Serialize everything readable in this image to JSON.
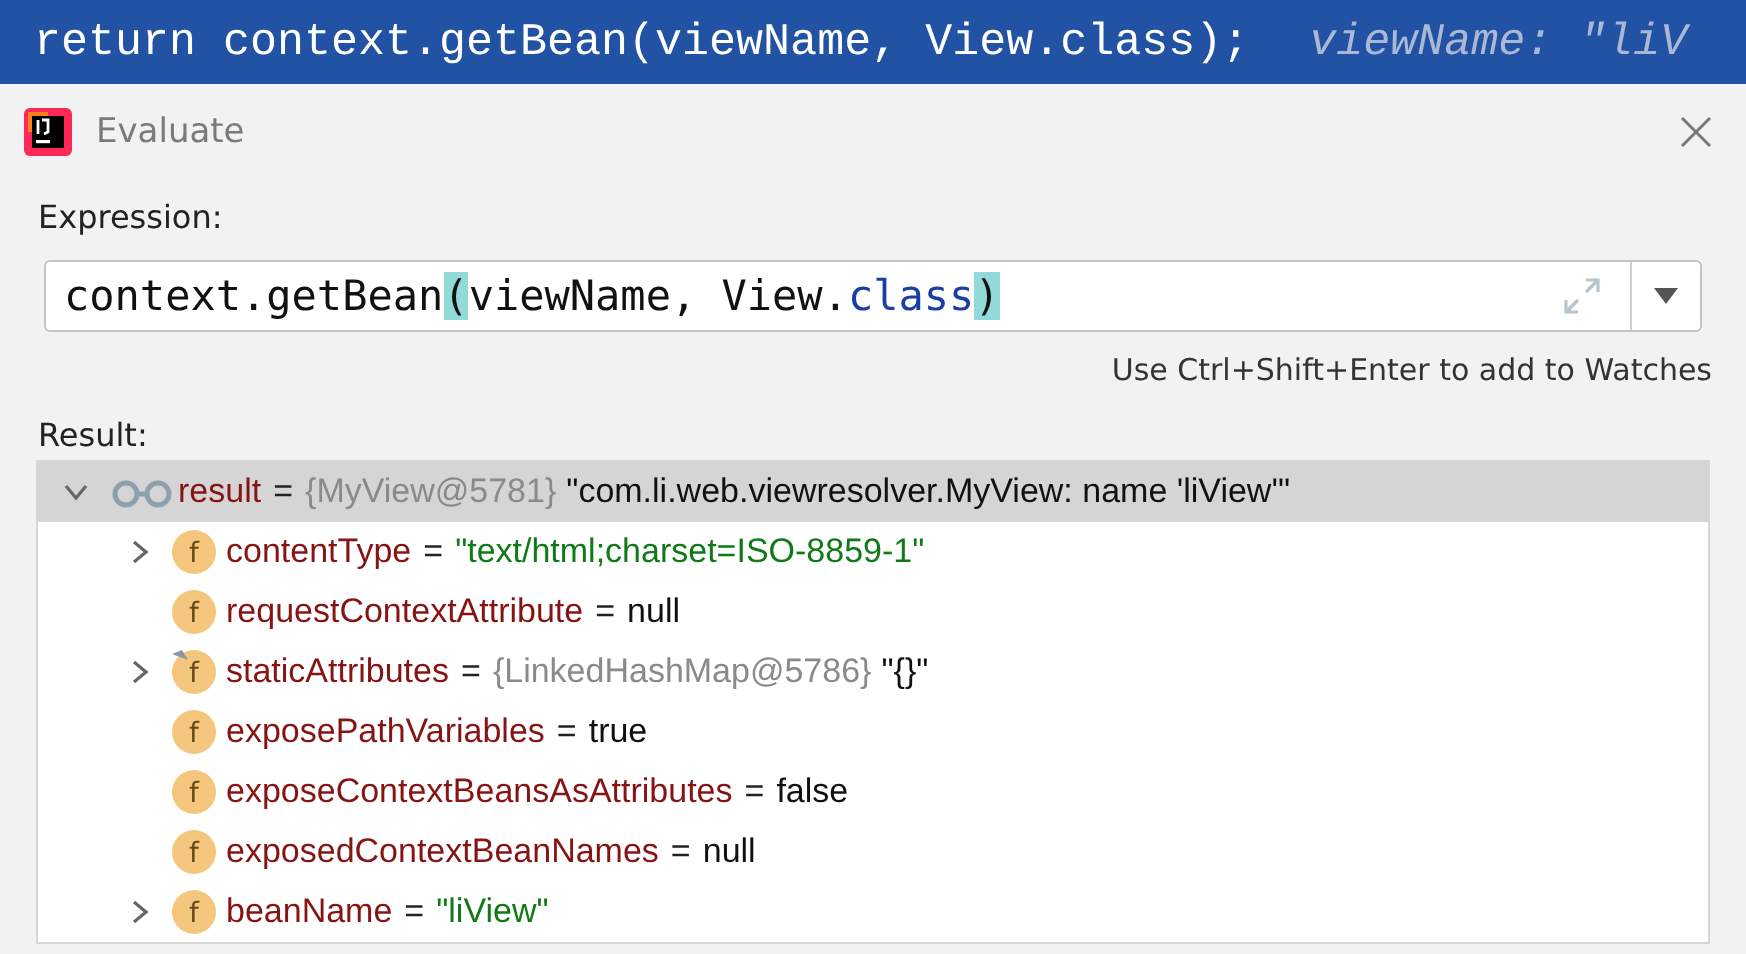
{
  "code_line": {
    "code": "return context.getBean(viewName, View.class);",
    "inline_hint": "viewName: \"liV"
  },
  "dialog": {
    "title": "Evaluate"
  },
  "expression": {
    "label": "Expression:",
    "segments": [
      {
        "text": "context.getBean",
        "kind": "plain"
      },
      {
        "text": "(",
        "kind": "brace_match"
      },
      {
        "text": "viewName, View.",
        "kind": "plain"
      },
      {
        "text": "class",
        "kind": "keyword"
      },
      {
        "text": ")",
        "kind": "brace_match"
      }
    ],
    "hint": "Use Ctrl+Shift+Enter to add to Watches"
  },
  "result": {
    "label": "Result:",
    "tree": [
      {
        "kind": "watch",
        "name": "result",
        "operator": "=",
        "type_ref": "{MyView@5781}",
        "value": {
          "text": "\"com.li.web.viewresolver.MyView: name 'liView'\"",
          "kind": "plain"
        },
        "selected": true,
        "expanded": true,
        "children": [
          {
            "kind": "field",
            "badge": "f",
            "name": "contentType",
            "operator": "=",
            "value": {
              "text": "\"text/html;charset=ISO-8859-1\"",
              "kind": "string"
            },
            "selected": false,
            "expanded": false
          },
          {
            "kind": "field",
            "badge": "f",
            "name": "requestContextAttribute",
            "operator": "=",
            "value": {
              "text": "null",
              "kind": "plain"
            },
            "selected": false
          },
          {
            "kind": "static_field",
            "badge": "f",
            "name": "staticAttributes",
            "operator": "=",
            "type_ref": "{LinkedHashMap@5786}",
            "value": {
              "text": "\"{}\"",
              "kind": "plain"
            },
            "selected": false,
            "expanded": false
          },
          {
            "kind": "field",
            "badge": "f",
            "name": "exposePathVariables",
            "operator": "=",
            "value": {
              "text": "true",
              "kind": "plain"
            },
            "selected": false
          },
          {
            "kind": "field",
            "badge": "f",
            "name": "exposeContextBeansAsAttributes",
            "operator": "=",
            "value": {
              "text": "false",
              "kind": "plain"
            },
            "selected": false
          },
          {
            "kind": "field",
            "badge": "f",
            "name": "exposedContextBeanNames",
            "operator": "=",
            "value": {
              "text": "null",
              "kind": "plain"
            },
            "selected": false
          },
          {
            "kind": "field",
            "badge": "f",
            "name": "beanName",
            "operator": "=",
            "value": {
              "text": "\"liView\"",
              "kind": "string"
            },
            "selected": false,
            "expanded": false
          }
        ]
      }
    ]
  }
}
